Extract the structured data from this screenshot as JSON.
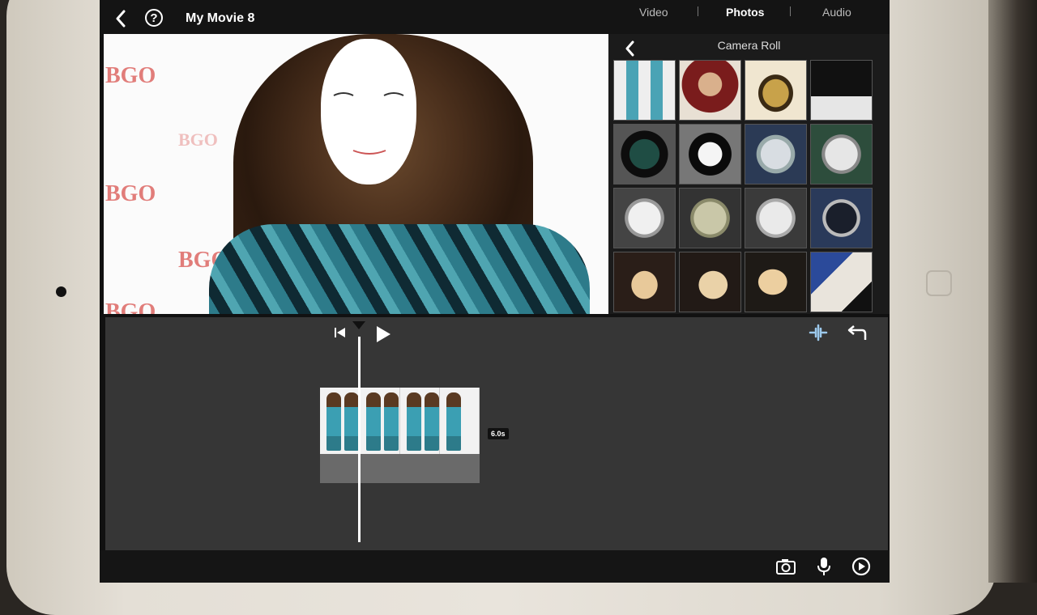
{
  "topbar": {
    "title": "My Movie 8",
    "help_glyph": "?",
    "tabs": [
      {
        "label": "Video"
      },
      {
        "label": "Photos",
        "active": true
      },
      {
        "label": "Audio"
      }
    ]
  },
  "viewer": {
    "background_logos": [
      "BGO",
      "BGO",
      "BGO",
      "BGO",
      "BGO"
    ]
  },
  "photo_browser": {
    "title": "Camera Roll",
    "thumbnail_rows": 4,
    "thumbnail_cols": 4
  },
  "timeline": {
    "clip_duration": "6.0s"
  },
  "icons": {
    "back": "chevron-left-icon",
    "help": "help-icon",
    "skip_back": "skip-to-start-icon",
    "play": "play-icon",
    "audio_wave": "audio-waveform-icon",
    "undo": "undo-icon",
    "camera": "camera-icon",
    "mic": "microphone-icon",
    "media": "media-icon"
  },
  "colors": {
    "accent": "#ffffff",
    "timeline_bg": "#363636",
    "bar_bg": "#141414"
  }
}
